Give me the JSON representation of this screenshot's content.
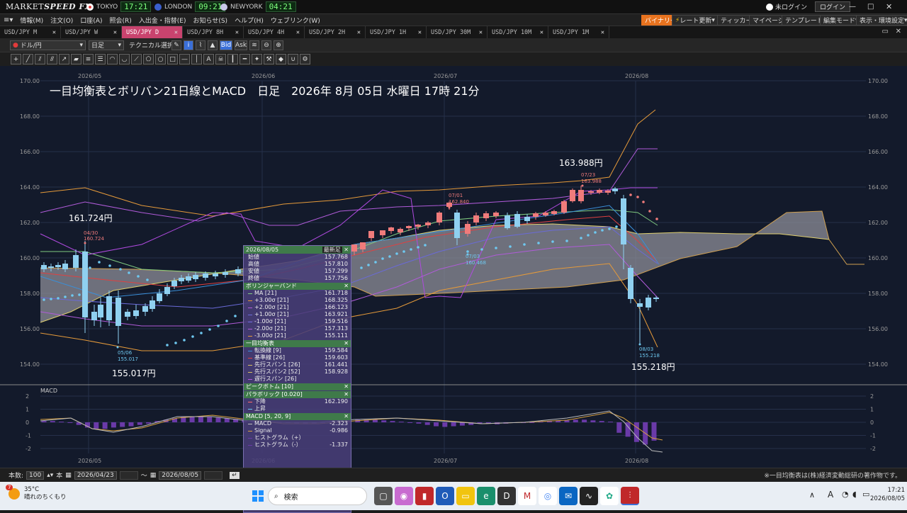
{
  "app": {
    "logo_prefix": "MARKET",
    "logo_suffix": "SPEED FX",
    "login_status": "未ログイン",
    "login_button": "ログイン"
  },
  "clocks": [
    {
      "city": "TOKYO",
      "time": "17:21",
      "color": "#e23b3b"
    },
    {
      "city": "LONDON",
      "time": "09:21",
      "color": "#3a5fcd"
    },
    {
      "city": "NEWYORK",
      "time": "04:21",
      "color": "#3a5fcd"
    }
  ],
  "menu": [
    "情報(M)",
    "注文(O)",
    "口座(A)",
    "照会(R)",
    "入出金・指替(E)",
    "お知らせ(S)",
    "ヘルプ(H)",
    "ウェブリンク(W)"
  ],
  "right_menu": [
    "バイナリー",
    "レート更新",
    "ティッカー",
    "マイページ",
    "テンプレート",
    "編集モード",
    "表示・環境設定"
  ],
  "tabs": [
    "USD/JPY M",
    "USD/JPY W",
    "USD/JPY D",
    "USD/JPY 8H",
    "USD/JPY 4H",
    "USD/JPY 2H",
    "USD/JPY 1H",
    "USD/JPY 30M",
    "USD/JPY 10M",
    "USD/JPY 1M"
  ],
  "active_tab_index": 2,
  "toolbar": {
    "pair": "ドル/円",
    "period": "日足",
    "tech": "テクニカル選択",
    "bid": "Bid",
    "ask": "Ask"
  },
  "chart": {
    "title": "一目均衡表とボリバン21日線とMACD　日足　2026年 8月 05日 水曜日 17時 21分",
    "months": [
      "2026/05",
      "2026/06",
      "2026/07",
      "2026/08"
    ],
    "price_ticks": [
      "170.00",
      "168.00",
      "166.00",
      "164.00",
      "162.00",
      "160.00",
      "158.00",
      "156.00",
      "154.00"
    ],
    "annotations": {
      "high1": "161.724円",
      "low1": "155.017円",
      "high2": "163.988円",
      "low2": "155.218円",
      "a1": "04/30",
      "a1v": "160.724",
      "a2": "05/06",
      "a2v": "155.017",
      "a3": "07/01",
      "a3v": "162.840",
      "a4": "07/03",
      "a4v": "160.468",
      "a5": "07/23",
      "a5v": "163.988",
      "a6": "08/03",
      "a6v": "155.218"
    },
    "macd_title": "MACD",
    "macd_ticks": [
      "2",
      "1",
      "0",
      "-1",
      "-2"
    ]
  },
  "legend": {
    "date": "2026/08/05",
    "mode": "最新足",
    "ohlc": [
      [
        "始値",
        "157.768"
      ],
      [
        "高値",
        "157.810"
      ],
      [
        "安値",
        "157.299"
      ],
      [
        "終値",
        "157.756"
      ]
    ],
    "boll_title": "ボリンジャーバンド",
    "boll": [
      [
        "MA [21]",
        "161.718"
      ],
      [
        "+3.00σ [21]",
        "168.325"
      ],
      [
        "+2.00σ [21]",
        "166.123"
      ],
      [
        "+1.00σ [21]",
        "163.921"
      ],
      [
        "-1.00σ [21]",
        "159.516"
      ],
      [
        "-2.00σ [21]",
        "157.313"
      ],
      [
        "-3.00σ [21]",
        "155.111"
      ]
    ],
    "ichi_title": "一目均衡表",
    "ichi": [
      [
        "転換線 [9]",
        "159.584"
      ],
      [
        "基準線 [26]",
        "159.603"
      ],
      [
        "先行スパン1 [26]",
        "161.441"
      ],
      [
        "先行スパン2 [52]",
        "158.928"
      ],
      [
        "遅行スパン [26]",
        ""
      ]
    ],
    "peak_title": "ピークボトム [10]",
    "sar_title": "パラボリック [0.020]",
    "sar": [
      [
        "下降",
        "162.190"
      ],
      [
        "上昇",
        ""
      ]
    ],
    "macd_title": "MACD [5, 20, 9]",
    "macd": [
      [
        "MACD",
        "-2.323"
      ],
      [
        "Signal",
        "-0.986"
      ],
      [
        "ヒストグラム（+）",
        ""
      ],
      [
        "ヒストグラム（-）",
        "-1.337"
      ]
    ]
  },
  "status": {
    "count_label": "本数:",
    "count": "100",
    "unit": "本",
    "from": "2026/04/23",
    "to": "2026/08/05",
    "copyright": "※一目均衡表は(株)経済変動総研の著作物です。"
  },
  "taskbar": {
    "temp": "35°C",
    "weather": "晴れのちくもり",
    "badge": "7",
    "search": "検索",
    "time": "17:21",
    "date": "2026/08/05",
    "ime": "A"
  },
  "chart_data": {
    "type": "candlestick",
    "title": "一目均衡表とボリバン21日線とMACD　日足　2026年 8月 05日 水曜日 17時 21分",
    "ylim": [
      154,
      170
    ],
    "key_points": [
      {
        "date": "04/30",
        "value": 160.724
      },
      {
        "date": "05/06",
        "value": 155.017
      },
      {
        "date": "07/01",
        "value": 162.84
      },
      {
        "date": "07/03",
        "value": 160.468
      },
      {
        "date": "07/23",
        "value": 163.988
      },
      {
        "date": "08/03",
        "value": 155.218
      }
    ],
    "last_ohlc": {
      "open": 157.768,
      "high": 157.81,
      "low": 157.299,
      "close": 157.756
    },
    "macd_ylim": [
      -2,
      2
    ]
  }
}
